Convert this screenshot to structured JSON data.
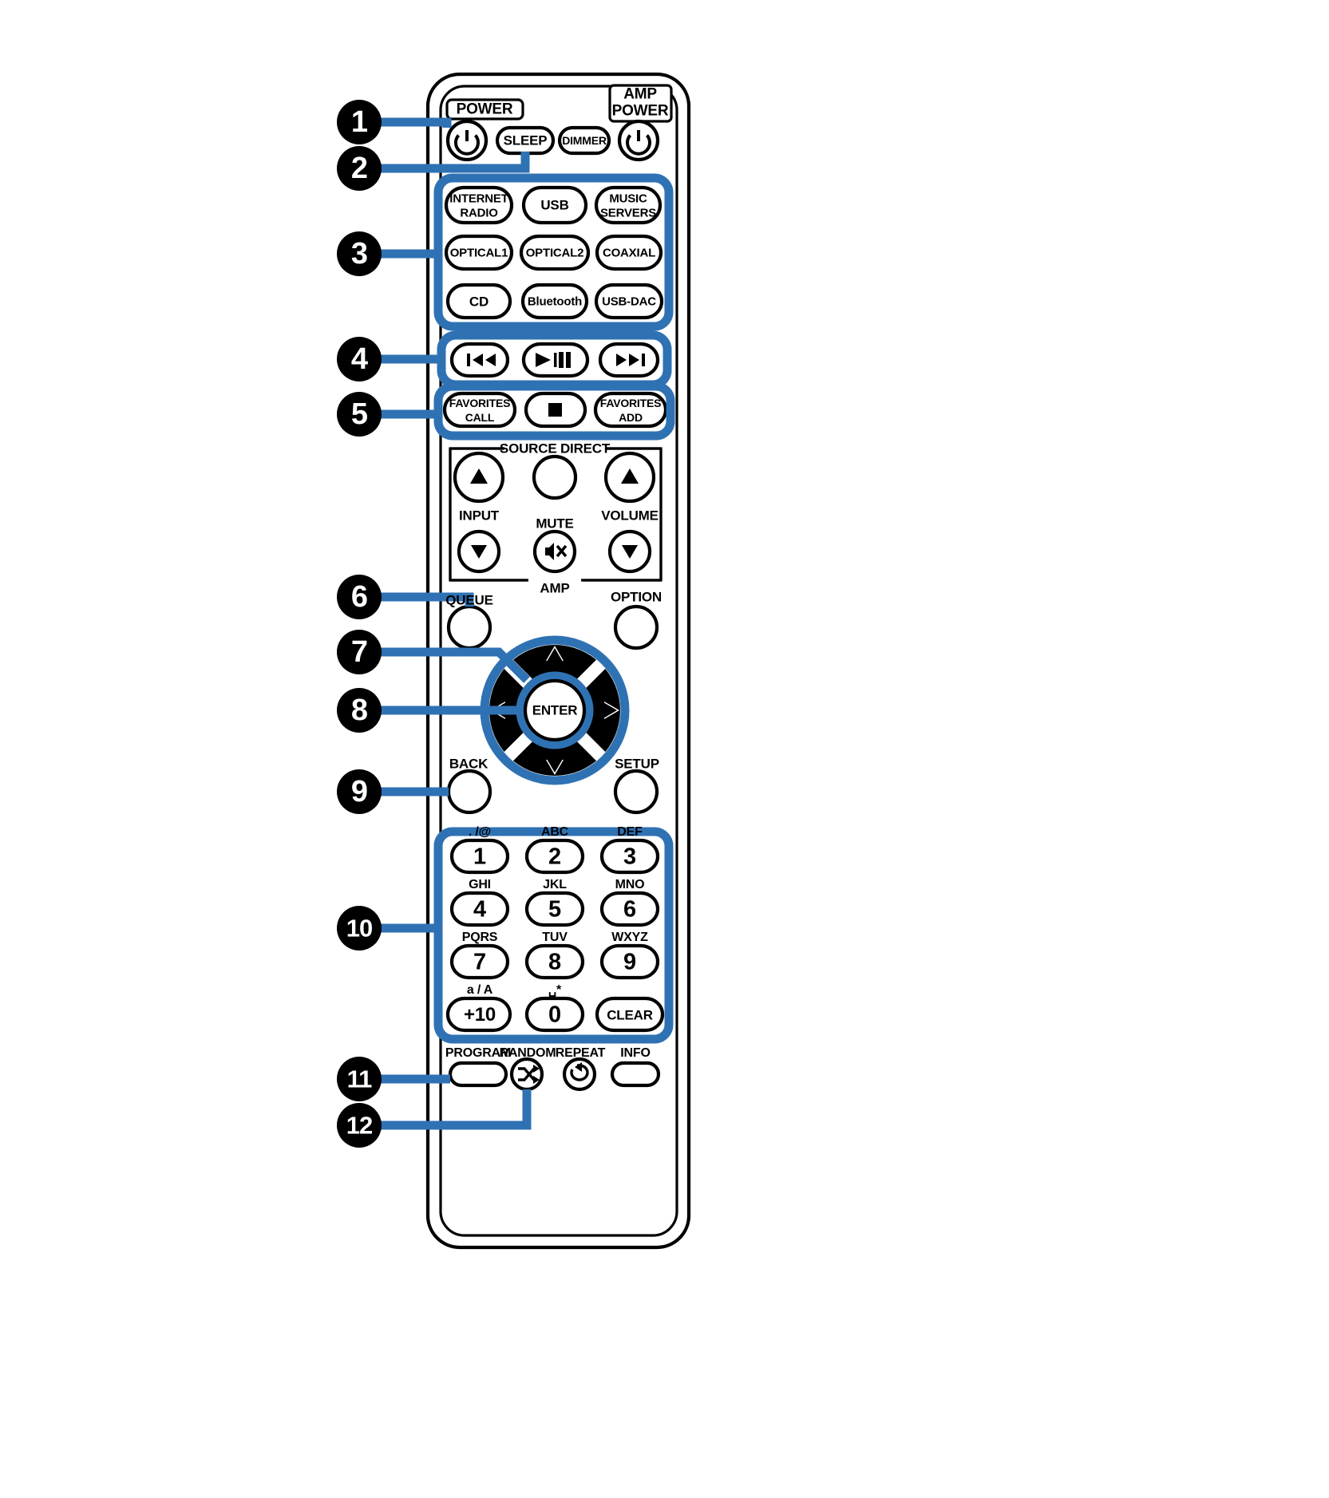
{
  "document": {
    "type": "remote-control-diagram",
    "device": "audio network player remote control",
    "colors": {
      "callout_blue": "#2f72b4",
      "outline_black": "#000000",
      "background": "#ffffff"
    }
  },
  "callouts": [
    {
      "id": 1,
      "label": "1",
      "target": "POWER button"
    },
    {
      "id": 2,
      "label": "2",
      "target": "SLEEP button"
    },
    {
      "id": 3,
      "label": "3",
      "target": "Input source select buttons"
    },
    {
      "id": 4,
      "label": "4",
      "target": "Playback system buttons"
    },
    {
      "id": 5,
      "label": "5",
      "target": "FAVORITES CALL / FAVORITES ADD buttons"
    },
    {
      "id": 6,
      "label": "6",
      "target": "QUEUE button"
    },
    {
      "id": 7,
      "label": "7",
      "target": "Cursor buttons"
    },
    {
      "id": 8,
      "label": "8",
      "target": "ENTER button"
    },
    {
      "id": 9,
      "label": "9",
      "target": "BACK button"
    },
    {
      "id": 10,
      "label": "10",
      "target": "Number buttons"
    },
    {
      "id": 11,
      "label": "11",
      "target": "PROGRAM button"
    },
    {
      "id": 12,
      "label": "12",
      "target": "RANDOM button"
    }
  ],
  "remote": {
    "power_row": {
      "power_badge": "POWER",
      "amp_power_badge_line1": "AMP",
      "amp_power_badge_line2": "POWER",
      "buttons": [
        {
          "name": "power",
          "glyph": "power-symbol"
        },
        {
          "name": "sleep",
          "label": "SLEEP"
        },
        {
          "name": "dimmer",
          "label": "DIMMER"
        },
        {
          "name": "amp-power",
          "glyph": "power-symbol"
        }
      ]
    },
    "input_sources": [
      {
        "label_line1": "INTERNET",
        "label_line2": "RADIO"
      },
      {
        "label_line1": "USB",
        "label_line2": ""
      },
      {
        "label_line1": "MUSIC",
        "label_line2": "SERVERS"
      },
      {
        "label_line1": "OPTICAL1",
        "label_line2": ""
      },
      {
        "label_line1": "OPTICAL2",
        "label_line2": ""
      },
      {
        "label_line1": "COAXIAL",
        "label_line2": ""
      },
      {
        "label_line1": "CD",
        "label_line2": ""
      },
      {
        "label_line1": "Bluetooth",
        "label_line2": ""
      },
      {
        "label_line1": "USB-DAC",
        "label_line2": ""
      }
    ],
    "transport": [
      {
        "name": "skip-back",
        "glyph": "previous-track"
      },
      {
        "name": "play-pause",
        "glyph": "play-pause"
      },
      {
        "name": "skip-forward",
        "glyph": "next-track"
      }
    ],
    "favorites_row": [
      {
        "name": "favorites-call",
        "label_line1": "FAVORITES",
        "label_line2": "CALL"
      },
      {
        "name": "stop",
        "glyph": "stop-square"
      },
      {
        "name": "favorites-add",
        "label_line1": "FAVORITES",
        "label_line2": "ADD"
      }
    ],
    "amp_section": {
      "title": "AMP",
      "source_direct_label": "SOURCE DIRECT",
      "input_label": "INPUT",
      "mute_label": "MUTE",
      "volume_label": "VOLUME",
      "buttons": [
        {
          "name": "input-up",
          "glyph": "triangle-up"
        },
        {
          "name": "source-direct",
          "glyph": "none"
        },
        {
          "name": "volume-up",
          "glyph": "triangle-up"
        },
        {
          "name": "input-down",
          "glyph": "triangle-down"
        },
        {
          "name": "mute",
          "glyph": "mute-speaker"
        },
        {
          "name": "volume-down",
          "glyph": "triangle-down"
        }
      ]
    },
    "nav_section": {
      "queue_label": "QUEUE",
      "option_label": "OPTION",
      "enter_label": "ENTER",
      "back_label": "BACK",
      "setup_label": "SETUP",
      "cursor_up": "triangle-up",
      "cursor_down": "triangle-down",
      "cursor_left": "triangle-left",
      "cursor_right": "triangle-right"
    },
    "keypad": [
      {
        "num": "1",
        "alpha": ". /@"
      },
      {
        "num": "2",
        "alpha": "ABC"
      },
      {
        "num": "3",
        "alpha": "DEF"
      },
      {
        "num": "4",
        "alpha": "GHI"
      },
      {
        "num": "5",
        "alpha": "JKL"
      },
      {
        "num": "6",
        "alpha": "MNO"
      },
      {
        "num": "7",
        "alpha": "PQRS"
      },
      {
        "num": "8",
        "alpha": "TUV"
      },
      {
        "num": "9",
        "alpha": "WXYZ"
      },
      {
        "num": "+10",
        "alpha": "a / A"
      },
      {
        "num": "0",
        "alpha": "␣*"
      },
      {
        "num": "CLEAR",
        "alpha": ""
      }
    ],
    "bottom_row": {
      "program_label": "PROGRAM",
      "random_label": "RANDOM",
      "repeat_label": "REPEAT",
      "info_label": "INFO",
      "random_glyph": "shuffle",
      "repeat_glyph": "repeat-loop"
    }
  }
}
